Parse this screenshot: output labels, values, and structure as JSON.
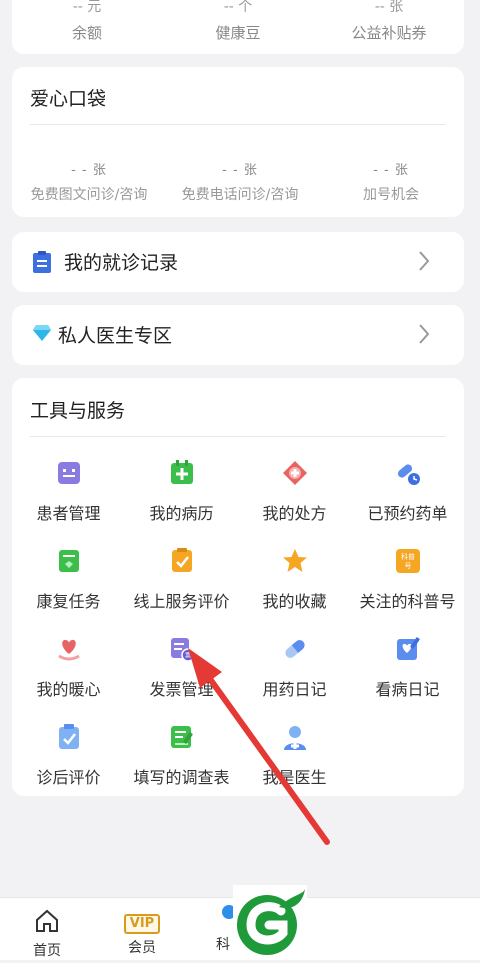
{
  "wallet": {
    "items": [
      {
        "value": "-- 元",
        "label": "余额"
      },
      {
        "value": "-- 个",
        "label": "健康豆"
      },
      {
        "value": "-- 张",
        "label": "公益补贴券"
      }
    ]
  },
  "pocket": {
    "title": "爱心口袋",
    "items": [
      {
        "value": "- - 张",
        "label": "免费图文问诊/咨询"
      },
      {
        "value": "- - 张",
        "label": "免费电话问诊/咨询"
      },
      {
        "value": "- - 张",
        "label": "加号机会"
      }
    ]
  },
  "visit_records": {
    "label": "我的就诊记录"
  },
  "private_doctor": {
    "label": "私人医生专区"
  },
  "tools": {
    "title": "工具与服务",
    "items": [
      {
        "label": "患者管理",
        "icon": "patient-management-icon"
      },
      {
        "label": "我的病历",
        "icon": "medical-record-icon"
      },
      {
        "label": "我的处方",
        "icon": "prescription-icon"
      },
      {
        "label": "已预约药单",
        "icon": "reserved-medicine-icon"
      },
      {
        "label": "康复任务",
        "icon": "recovery-task-icon"
      },
      {
        "label": "线上服务评价",
        "icon": "service-review-icon"
      },
      {
        "label": "我的收藏",
        "icon": "favorites-star-icon"
      },
      {
        "label": "关注的科普号",
        "icon": "science-account-icon"
      },
      {
        "label": "我的暖心",
        "icon": "warm-heart-icon"
      },
      {
        "label": "发票管理",
        "icon": "invoice-icon"
      },
      {
        "label": "用药日记",
        "icon": "pill-diary-icon"
      },
      {
        "label": "看病日记",
        "icon": "visit-diary-icon"
      },
      {
        "label": "诊后评价",
        "icon": "post-visit-review-icon"
      },
      {
        "label": "填写的调查表",
        "icon": "survey-icon"
      },
      {
        "label": "我是医生",
        "icon": "doctor-icon"
      }
    ]
  },
  "bottom_nav": {
    "items": [
      {
        "label": "首页",
        "icon": "home-icon"
      },
      {
        "label": "会员",
        "icon": "vip-icon",
        "badge": "VIP"
      },
      {
        "label": "科",
        "icon": "science-icon"
      }
    ]
  },
  "colors": {
    "accent_red": "#e53935",
    "green": "#3cbf4a",
    "blue": "#3d6fe0",
    "purple": "#7b6cd9",
    "orange": "#f5a623"
  }
}
